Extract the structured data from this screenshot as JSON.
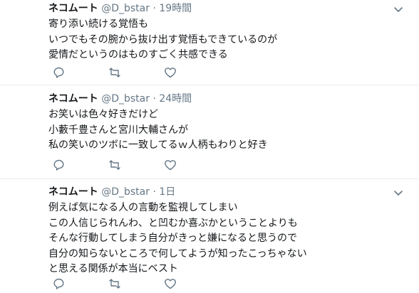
{
  "tweets": [
    {
      "name": "ネコムート",
      "handle": "@D_bstar",
      "sep": "·",
      "time": "19時間",
      "lines": [
        "寄り添い続ける覚悟も",
        "いつでもその腕から抜け出す覚悟もできているのが",
        "愛情だというのはものすごく共感できる"
      ]
    },
    {
      "name": "ネコムート",
      "handle": "@D_bstar",
      "sep": "·",
      "time": "24時間",
      "lines": [
        "お笑いは色々好きだけど",
        "小藪千豊さんと宮川大輔さんが",
        "私の笑いのツボに一致してるｗ人柄もわりと好き"
      ]
    },
    {
      "name": "ネコムート",
      "handle": "@D_bstar",
      "sep": "·",
      "time": "1日",
      "lines": [
        "例えば気になる人の言動を監視してしまい",
        "この人信じられんわ、と凹むか喜ぶかということよりも",
        "そんな行動してしまう自分がきっと嫌になると思うので",
        "自分の知らないところで何してようが知ったこっちゃない",
        "と思える関係が本当にベスト"
      ]
    }
  ],
  "colors": {
    "text": "#14171a",
    "muted": "#657786",
    "divider": "#e6ecf0"
  }
}
